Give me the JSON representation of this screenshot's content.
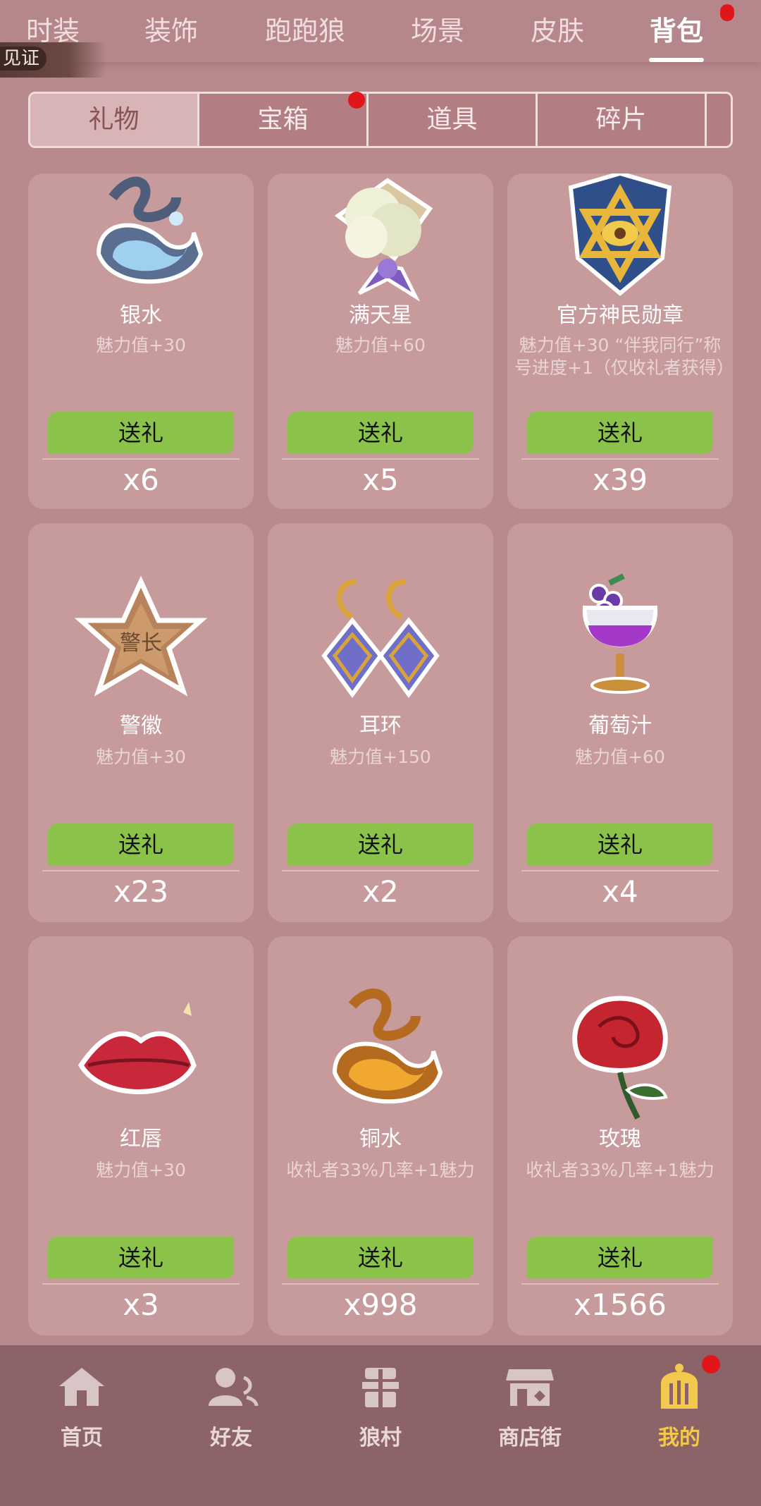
{
  "top_tabs": [
    "时装",
    "装饰",
    "跑跑狼",
    "场景",
    "皮肤",
    "背包"
  ],
  "witness_label": "见证",
  "sub_tabs": [
    "礼物",
    "宝箱",
    "道具",
    "碎片"
  ],
  "cards": [
    {
      "name": "银水",
      "desc": "魅力值+30",
      "button": "送礼",
      "count": "x6",
      "icon": "silver-water-icon"
    },
    {
      "name": "满天星",
      "desc": "魅力值+60",
      "button": "送礼",
      "count": "x5",
      "icon": "babys-breath-bouquet-icon"
    },
    {
      "name": "官方神民勋章",
      "desc": "魅力值+30 “伴我同行”称号进度+1（仅收礼者获得）",
      "button": "送礼",
      "count": "x39",
      "icon": "medal-icon"
    },
    {
      "name": "警徽",
      "desc": "魅力值+30",
      "button": "送礼",
      "count": "x23",
      "icon": "police-badge-icon"
    },
    {
      "name": "耳环",
      "desc": "魅力值+150",
      "button": "送礼",
      "count": "x2",
      "icon": "earrings-icon"
    },
    {
      "name": "葡萄汁",
      "desc": "魅力值+60",
      "button": "送礼",
      "count": "x4",
      "icon": "grape-juice-icon"
    },
    {
      "name": "红唇",
      "desc": "魅力值+30",
      "button": "送礼",
      "count": "x3",
      "icon": "red-lips-icon"
    },
    {
      "name": "铜水",
      "desc": "收礼者33%几率+1魅力",
      "button": "送礼",
      "count": "x998",
      "icon": "copper-water-icon"
    },
    {
      "name": "玫瑰",
      "desc": "收礼者33%几率+1魅力",
      "button": "送礼",
      "count": "x1566",
      "icon": "rose-icon"
    }
  ],
  "bottom_nav": [
    {
      "label": "首页",
      "icon": "home-icon"
    },
    {
      "label": "好友",
      "icon": "friends-icon"
    },
    {
      "label": "狼村",
      "icon": "village-icon"
    },
    {
      "label": "商店街",
      "icon": "shop-icon"
    },
    {
      "label": "我的",
      "icon": "profile-icon"
    }
  ],
  "colors": {
    "accent_green": "#8bc34a",
    "active_nav": "#f2c94c",
    "badge_red": "#e0161b"
  }
}
